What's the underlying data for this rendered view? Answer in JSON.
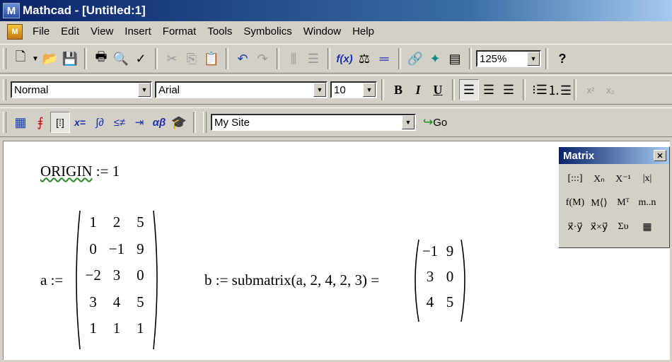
{
  "title": "Mathcad - [Untitled:1]",
  "menu": [
    "File",
    "Edit",
    "View",
    "Insert",
    "Format",
    "Tools",
    "Symbolics",
    "Window",
    "Help"
  ],
  "toolbar": {
    "zoom": "125%"
  },
  "format_bar": {
    "style": "Normal",
    "font": "Arial",
    "size": "10",
    "bold": "B",
    "italic": "I",
    "underline": "U",
    "superscript": "x²",
    "subscript": "x₂"
  },
  "math_bar": {
    "site": "My Site",
    "go": "Go"
  },
  "worksheet": {
    "origin": {
      "name": "ORIGIN",
      "assign": ":=",
      "value": "1"
    },
    "a_label": "a :=",
    "matrix_a": [
      [
        "1",
        "2",
        "5"
      ],
      [
        "0",
        "−1",
        "9"
      ],
      [
        "−2",
        "3",
        "0"
      ],
      [
        "3",
        "4",
        "5"
      ],
      [
        "1",
        "1",
        "1"
      ]
    ],
    "b_expr": "b := submatrix(a, 2, 4, 2, 3) =",
    "matrix_b": [
      [
        "−1",
        "9"
      ],
      [
        "3",
        "0"
      ],
      [
        "4",
        "5"
      ]
    ]
  },
  "matrix_palette": {
    "title": "Matrix",
    "buttons": [
      "[:::]",
      "Xₙ",
      "X⁻¹",
      "|x|",
      "f(M)",
      "M⟨⟩",
      "Mᵀ",
      "m..n",
      "x⃗·y⃗",
      "x⃗×y⃗",
      "Συ",
      "▦"
    ]
  }
}
